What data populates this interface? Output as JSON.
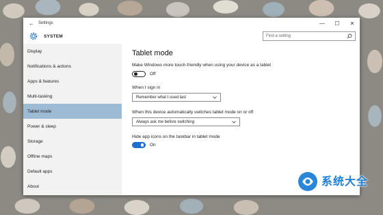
{
  "window": {
    "title": "Settings",
    "controls": [
      "—",
      "☐",
      "✕"
    ]
  },
  "header": {
    "section": "SYSTEM",
    "search_placeholder": "Find a setting"
  },
  "sidebar": {
    "items": [
      {
        "label": "Display",
        "active": false
      },
      {
        "label": "Notifications & actions",
        "active": false
      },
      {
        "label": "Apps & features",
        "active": false
      },
      {
        "label": "Multi-tasking",
        "active": false
      },
      {
        "label": "Tablet mode",
        "active": true
      },
      {
        "label": "Power & sleep",
        "active": false
      },
      {
        "label": "Storage",
        "active": false
      },
      {
        "label": "Offline maps",
        "active": false
      },
      {
        "label": "Default apps",
        "active": false
      },
      {
        "label": "About",
        "active": false
      }
    ]
  },
  "main": {
    "title": "Tablet mode",
    "touch_desc": "Make Windows more touch-friendly when using your device as a tablet",
    "touch_toggle_label": "Off",
    "signin_label": "When I sign in",
    "signin_value": "Remember what I used last",
    "switch_label": "When this device automatically switches tablet mode on or off",
    "switch_value": "Always ask me before switching",
    "hide_icons_label": "Hide app icons on the taskbar in tablet mode",
    "hide_icons_toggle_label": "On"
  },
  "watermark": {
    "text": "系统大全"
  },
  "colors": {
    "accent": "#1f6fcf",
    "active_nav": "#9ebbd5"
  }
}
